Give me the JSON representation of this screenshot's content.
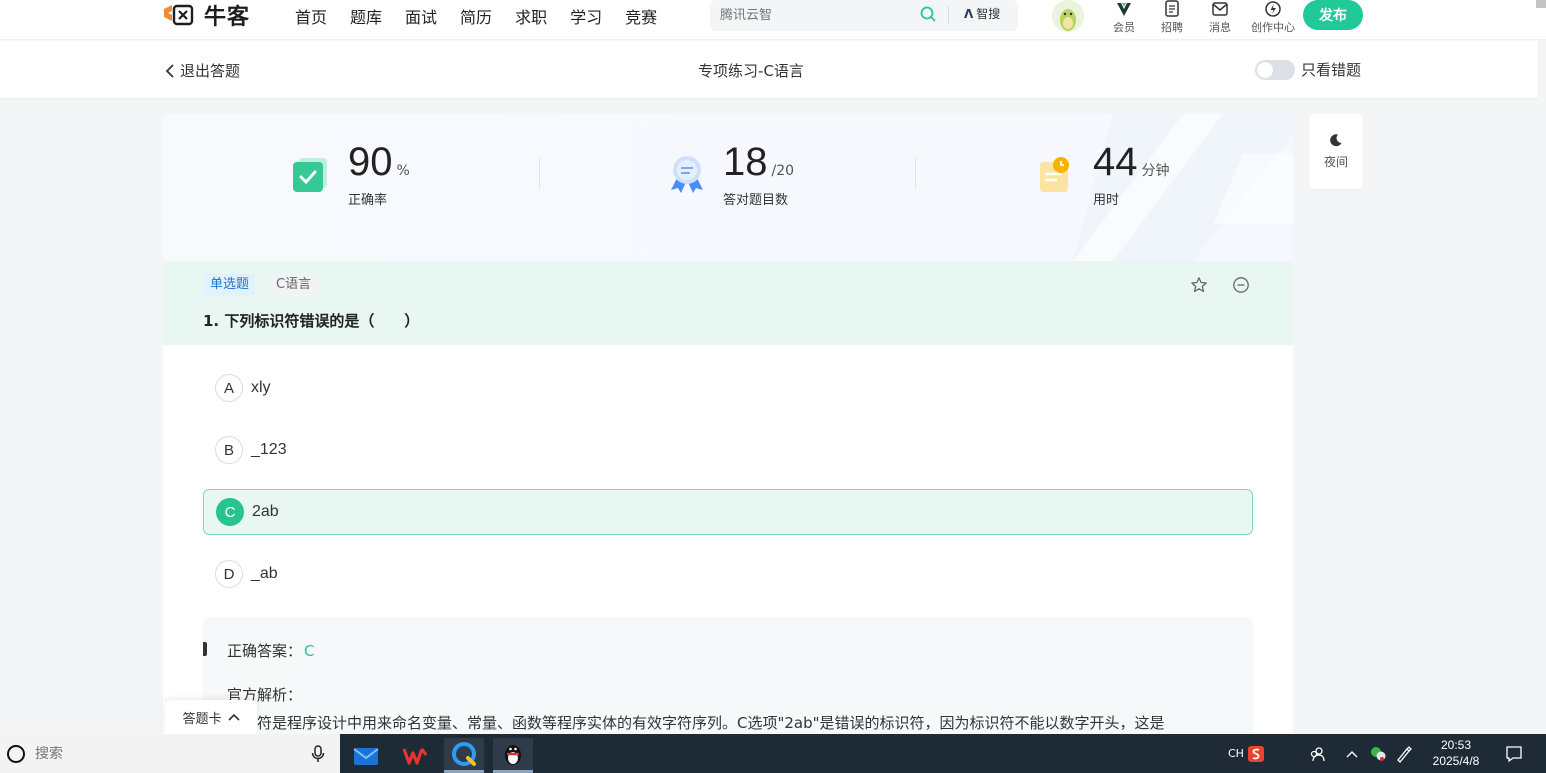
{
  "nav": {
    "logo_text": "牛客",
    "links": [
      "首页",
      "题库",
      "面试",
      "简历",
      "求职",
      "学习",
      "竞赛"
    ],
    "search_placeholder": "腾讯云智",
    "zhisou_label": "智搜",
    "icons": [
      {
        "label": "会员",
        "icon": "vip-icon"
      },
      {
        "label": "招聘",
        "icon": "recruit-icon"
      },
      {
        "label": "消息",
        "icon": "mail-icon"
      },
      {
        "label": "创作中心",
        "icon": "creator-icon"
      }
    ],
    "publish_label": "发布"
  },
  "subheader": {
    "exit_label": "退出答题",
    "title": "专项练习-C语言",
    "toggle_label": "只看错题"
  },
  "stats": {
    "accuracy": {
      "value": "90",
      "unit": "%",
      "label": "正确率"
    },
    "correct": {
      "value": "18",
      "unit": "/20",
      "label": "答对题目数"
    },
    "time": {
      "value": "44",
      "unit": "分钟",
      "label": "用时"
    }
  },
  "question": {
    "type_tag": "单选题",
    "topic_tag": "C语言",
    "text": "1. 下列标识符错误的是（　　）",
    "options": [
      {
        "letter": "A",
        "text": "xly",
        "selected": false
      },
      {
        "letter": "B",
        "text": "_123",
        "selected": false
      },
      {
        "letter": "C",
        "text": "2ab",
        "selected": true
      },
      {
        "letter": "D",
        "text": "_ab",
        "selected": false
      }
    ]
  },
  "answer": {
    "label": "正确答案：",
    "value": "C",
    "analysis_title": "官方解析：",
    "analysis_text": "符是程序设计中用来命名变量、常量、函数等程序实体的有效字符序列。C选项\"2ab\"是错误的标识符，因为标识符不能以数字开头，这是"
  },
  "answer_card_label": "答题卡",
  "night_label": "夜间",
  "taskbar": {
    "search_placeholder": "搜索",
    "ime": "CH",
    "time": "20:53",
    "date": "2025/4/8"
  },
  "colors": {
    "accent": "#20c997",
    "correct_green": "#28c38f",
    "tag_blue": "#2472c8"
  }
}
